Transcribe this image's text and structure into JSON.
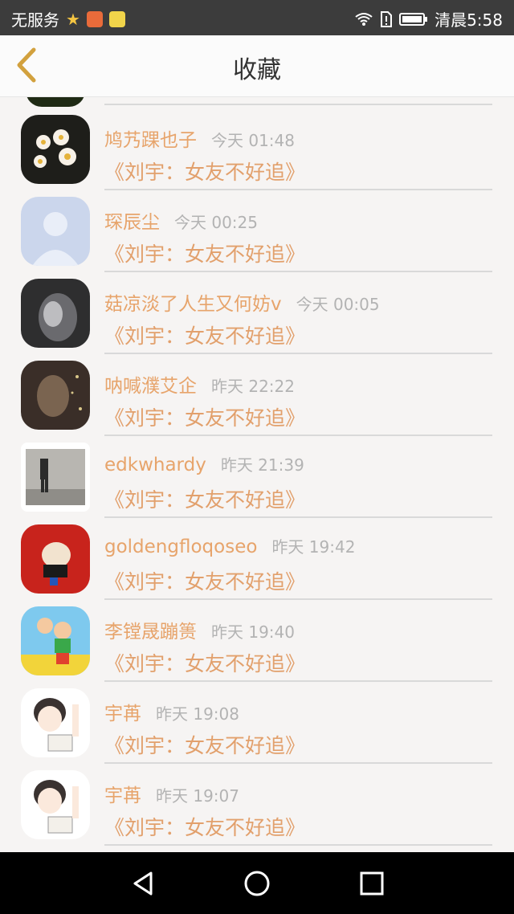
{
  "status_bar": {
    "carrier": "无服务",
    "time": "清晨5:58"
  },
  "header": {
    "title": "收藏"
  },
  "items": [
    {
      "name": "鸠艿踝也子",
      "time": "今天 01:48",
      "book": "《刘宇：女友不好追》"
    },
    {
      "name": "琛辰尘",
      "time": "今天 00:25",
      "book": "《刘宇：女友不好追》"
    },
    {
      "name": "菇凉淡了人生又何妨v",
      "time": "今天 00:05",
      "book": "《刘宇：女友不好追》"
    },
    {
      "name": "呐喊濮艾企",
      "time": "昨天 22:22",
      "book": "《刘宇：女友不好追》"
    },
    {
      "name": "edkwhardy",
      "time": "昨天 21:39",
      "book": "《刘宇：女友不好追》"
    },
    {
      "name": "goldengfloqoseo",
      "time": "昨天 19:42",
      "book": "《刘宇：女友不好追》"
    },
    {
      "name": "李镗晟蹦篑",
      "time": "昨天 19:40",
      "book": "《刘宇：女友不好追》"
    },
    {
      "name": "宇苒",
      "time": "昨天 19:08",
      "book": "《刘宇：女友不好追》"
    },
    {
      "name": "宇苒",
      "time": "昨天 19:07",
      "book": "《刘宇：女友不好追》"
    }
  ]
}
